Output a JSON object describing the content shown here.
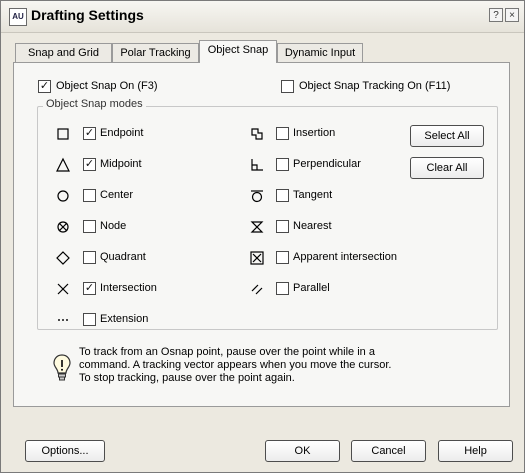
{
  "window": {
    "title": "Drafting Settings",
    "help_glyph": "?",
    "close_glyph": "×"
  },
  "tabs": [
    {
      "label": "Snap and Grid"
    },
    {
      "label": "Polar Tracking"
    },
    {
      "label": "Object Snap",
      "active": true
    },
    {
      "label": "Dynamic Input"
    }
  ],
  "object_snap_on": {
    "label": "Object Snap On (F3)",
    "checked": true
  },
  "object_snap_tracking": {
    "label": "Object Snap Tracking On (F11)",
    "checked": false
  },
  "modes_group_title": "Object Snap modes",
  "modes_left": [
    {
      "label": "Endpoint",
      "checked": true,
      "icon": "endpoint-icon"
    },
    {
      "label": "Midpoint",
      "checked": true,
      "icon": "midpoint-icon"
    },
    {
      "label": "Center",
      "checked": false,
      "icon": "center-icon"
    },
    {
      "label": "Node",
      "checked": false,
      "icon": "node-icon"
    },
    {
      "label": "Quadrant",
      "checked": false,
      "icon": "quadrant-icon"
    },
    {
      "label": "Intersection",
      "checked": true,
      "icon": "intersection-icon"
    },
    {
      "label": "Extension",
      "checked": false,
      "icon": "extension-icon"
    }
  ],
  "modes_right": [
    {
      "label": "Insertion",
      "checked": false,
      "icon": "insertion-icon"
    },
    {
      "label": "Perpendicular",
      "checked": false,
      "icon": "perpendicular-icon"
    },
    {
      "label": "Tangent",
      "checked": false,
      "icon": "tangent-icon"
    },
    {
      "label": "Nearest",
      "checked": false,
      "icon": "nearest-icon"
    },
    {
      "label": "Apparent intersection",
      "checked": false,
      "icon": "apparent-intersection-icon"
    },
    {
      "label": "Parallel",
      "checked": false,
      "icon": "parallel-icon"
    }
  ],
  "buttons": {
    "select_all": "Select All",
    "clear_all": "Clear All",
    "options": "Options...",
    "ok": "OK",
    "cancel": "Cancel",
    "help": "Help"
  },
  "hint": {
    "line1": "To track from an Osnap point, pause over the point while in a",
    "line2": "command.  A tracking vector appears when you move the cursor.",
    "line3": "To stop tracking, pause over the point again."
  },
  "check_glyph": "✓"
}
